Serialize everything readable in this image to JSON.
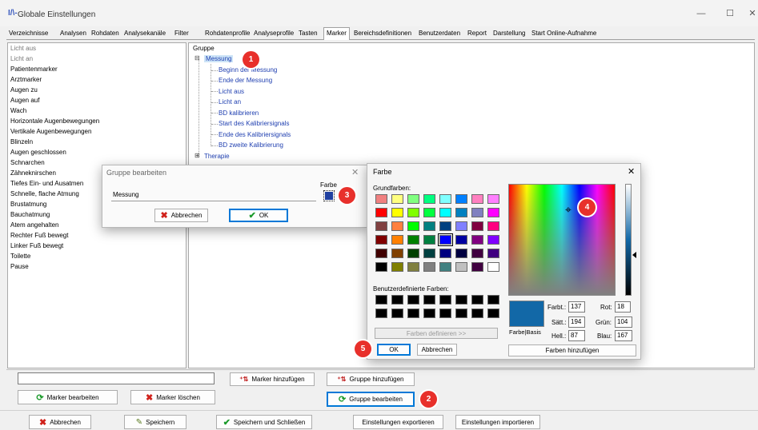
{
  "window": {
    "title": "Globale Einstellungen",
    "logo": "I/\\-",
    "minimize": "—",
    "maximize": "☐",
    "close": "✕"
  },
  "tabs": [
    "Verzeichnisse",
    "Analysen",
    "Rohdaten",
    "Analysekanäle",
    "Filter",
    "Rohdatenprofile",
    "Analyseprofile",
    "Tasten",
    "Marker",
    "Bereichsdefinitionen",
    "Benutzerdaten",
    "Report",
    "Darstellung",
    "Start Online-Aufnahme"
  ],
  "active_tab": "Marker",
  "marker_list": [
    "Licht aus",
    "Licht an",
    "Patientenmarker",
    "Arztmarker",
    "Augen zu",
    "Augen auf",
    "Wach",
    "Horizontale Augenbewegungen",
    "Vertikale Augenbewegungen",
    "Blinzeln",
    "Augen geschlossen",
    "Schnarchen",
    "Zähneknirschen",
    "Tiefes Ein- und Ausatmen",
    "Schnelle, flache Atmung",
    "Brustatmung",
    "Bauchatmung",
    "Atem angehalten",
    "Rechter Fuß bewegt",
    "Linker Fuß bewegt",
    "Toilette",
    "Pause"
  ],
  "tree": {
    "root": "Gruppe",
    "group1": "Messung",
    "group1_expander": "⊟",
    "children": [
      "Beginn der Messung",
      "Ende der Messung",
      "Licht aus",
      "Licht an",
      "BD kalibrieren",
      "Start des Kalibriersignals",
      "Ende des Kalibriersignals",
      "BD zweite Kalibrierung"
    ],
    "group2": "Therapie",
    "group2_expander": "⊞"
  },
  "badges": {
    "b1": "1",
    "b2": "2",
    "b3": "3",
    "b4": "4",
    "b5": "5"
  },
  "bottom": {
    "search_value": "",
    "add_marker": "Marker hinzufügen",
    "add_group": "Gruppe hinzufügen",
    "edit_marker": "Marker bearbeiten",
    "delete_marker": "Marker löschen",
    "edit_group": "Gruppe bearbeiten"
  },
  "footer": {
    "cancel": "Abbrechen",
    "save": "Speichern",
    "save_close": "Speichern und Schließen",
    "export": "Einstellungen exportieren",
    "import": "Einstellungen importieren"
  },
  "group_dialog": {
    "title": "Gruppe bearbeiten",
    "name_value": "Messung",
    "color_label": "Farbe",
    "color": "#2040a0",
    "cancel": "Abbrechen",
    "ok": "OK",
    "close": "✕"
  },
  "color_dialog": {
    "title": "Farbe",
    "close": "✕",
    "basic_label": "Grundfarben:",
    "custom_label": "Benutzerdefinierte Farben:",
    "define_btn": "Farben definieren >>",
    "ok": "OK",
    "cancel": "Abbrechen",
    "add_btn": "Farben hinzufügen",
    "preview_label": "Farbe|Basis",
    "preview_color": "#1268a7",
    "fields": {
      "hue_label": "Farbt.:",
      "hue": "137",
      "sat_label": "Sätt.:",
      "sat": "194",
      "lum_label": "Hell.:",
      "lum": "87",
      "red_label": "Rot:",
      "red": "18",
      "green_label": "Grün:",
      "green": "104",
      "blue_label": "Blau:",
      "blue": "167"
    },
    "basic_colors": [
      "#f08080",
      "#ffff80",
      "#80ff80",
      "#00ff80",
      "#80ffff",
      "#0080ff",
      "#ff80c0",
      "#ff80ff",
      "#ff0000",
      "#ffff00",
      "#80ff00",
      "#00ff40",
      "#00ffff",
      "#0080c0",
      "#8080c0",
      "#ff00ff",
      "#804040",
      "#ff8040",
      "#00ff00",
      "#008080",
      "#004080",
      "#8080ff",
      "#800040",
      "#ff0080",
      "#800000",
      "#ff8000",
      "#008000",
      "#008040",
      "#0000ff",
      "#0000a0",
      "#800080",
      "#8000ff",
      "#400000",
      "#804000",
      "#004000",
      "#004040",
      "#000080",
      "#000040",
      "#400040",
      "#400080",
      "#000000",
      "#808000",
      "#808040",
      "#808080",
      "#408080",
      "#c0c0c0",
      "#400040",
      "#ffffff"
    ]
  }
}
